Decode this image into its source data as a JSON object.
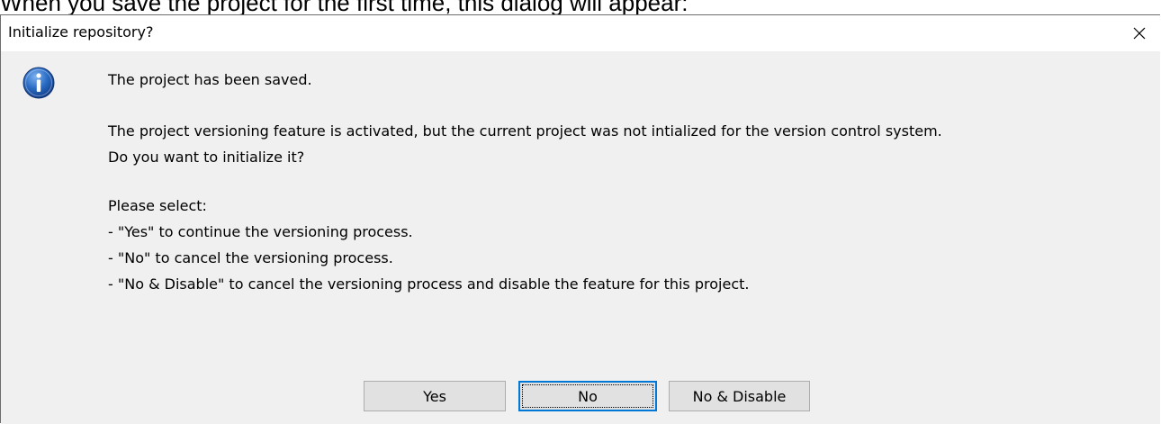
{
  "caption": "When you save the project for the first time, this dialog will appear:",
  "dialog": {
    "title": "Initialize repository?",
    "close_icon": "close-icon",
    "info_icon": "information-icon",
    "message": {
      "line1": "The project has been saved.",
      "line2": "The project versioning feature is activated, but the current project was not intialized for the version control system.",
      "line3": "Do you want to initialize it?",
      "line4": "Please select:",
      "line5": "- \"Yes\" to continue the versioning process.",
      "line6": "- \"No\" to cancel the versioning process.",
      "line7": "- \"No & Disable\" to cancel the versioning process and disable the feature for this project."
    },
    "buttons": {
      "yes": "Yes",
      "no": "No",
      "no_disable": "No & Disable"
    },
    "focused_button": "no"
  },
  "colors": {
    "client_background": "#f0f0f0",
    "button_face": "#e1e1e1",
    "focus_border": "#0078d7",
    "info_icon_blue": "#1e5fb8"
  }
}
